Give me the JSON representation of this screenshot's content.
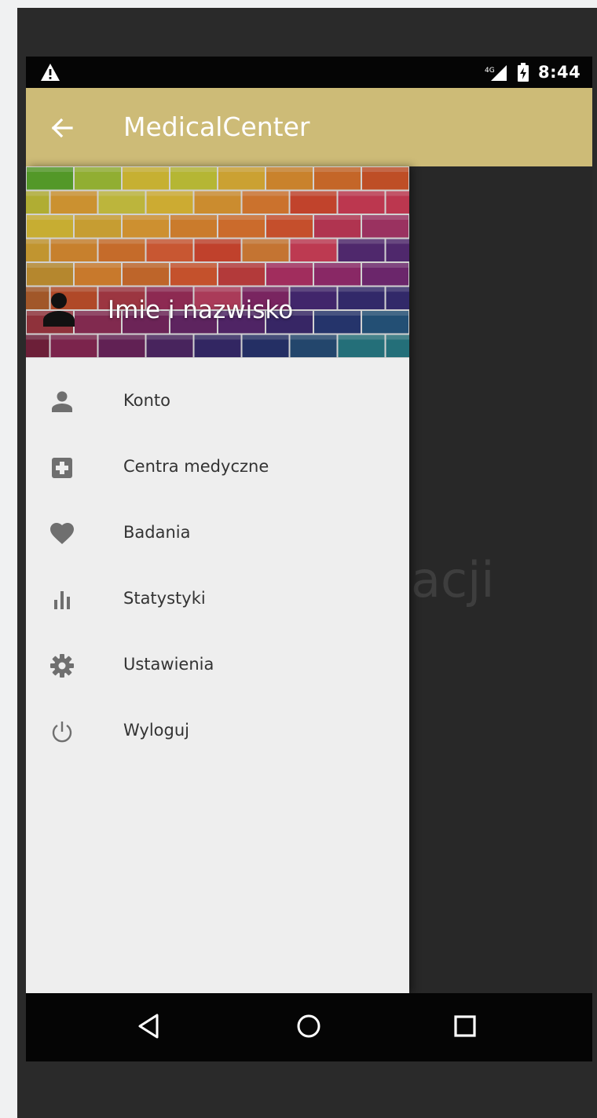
{
  "status_bar": {
    "time": "8:44",
    "icons": [
      "warning-icon",
      "signal-icon",
      "battery-icon"
    ]
  },
  "app_bar": {
    "title": "MedicalCenter",
    "back_icon": "arrow-back-icon"
  },
  "background": {
    "partial_text": "acji"
  },
  "drawer": {
    "header": {
      "name": "Imie i nazwisko",
      "icon": "person-icon"
    },
    "items": [
      {
        "label": "Konto",
        "icon": "person-icon"
      },
      {
        "label": "Centra medyczne",
        "icon": "medical-plus-icon"
      },
      {
        "label": "Badania",
        "icon": "heart-icon"
      },
      {
        "label": "Statystyki",
        "icon": "bar-chart-icon"
      },
      {
        "label": "Ustawienia",
        "icon": "gear-icon"
      },
      {
        "label": "Wyloguj",
        "icon": "power-icon"
      }
    ]
  },
  "nav_bar": {
    "icons": [
      "nav-back-icon",
      "nav-home-icon",
      "nav-recent-icon"
    ]
  },
  "colors": {
    "app_bar": "#cdbb77",
    "drawer_bg": "#eeeeee",
    "screen_bg": "#282828",
    "status_bar": "#050505",
    "icon_gray": "#6f6f6f"
  }
}
